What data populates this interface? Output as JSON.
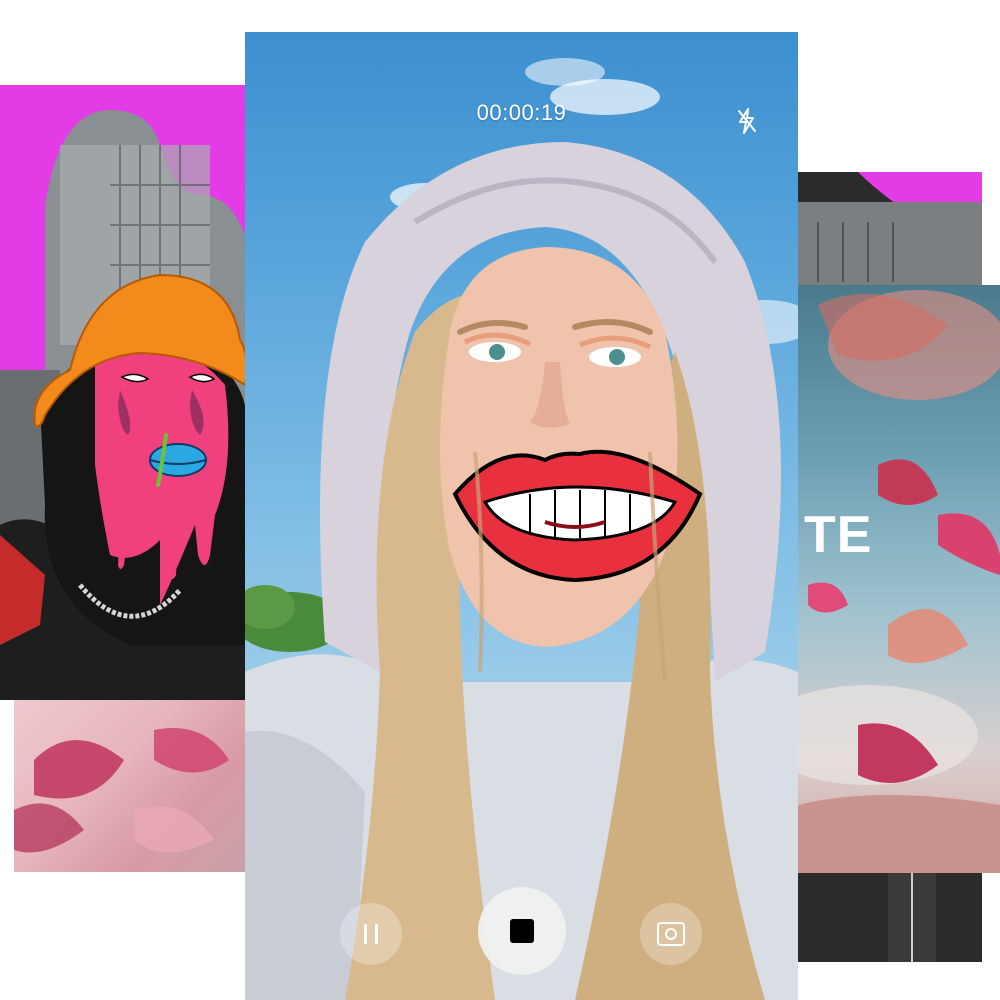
{
  "recorder": {
    "timer": "00:00:19"
  },
  "side_card": {
    "partial_text": "TE"
  },
  "icons": {
    "flash": "flash-off-icon",
    "pause": "pause-icon",
    "stop": "stop-icon",
    "snapshot": "camera-snapshot-icon"
  },
  "colors": {
    "accent_magenta": "#e33be6",
    "lips_red": "#e8303f",
    "sky_blue": "#5aa6dc",
    "hat_orange": "#f28a1c",
    "face_pink": "#f0407e"
  }
}
